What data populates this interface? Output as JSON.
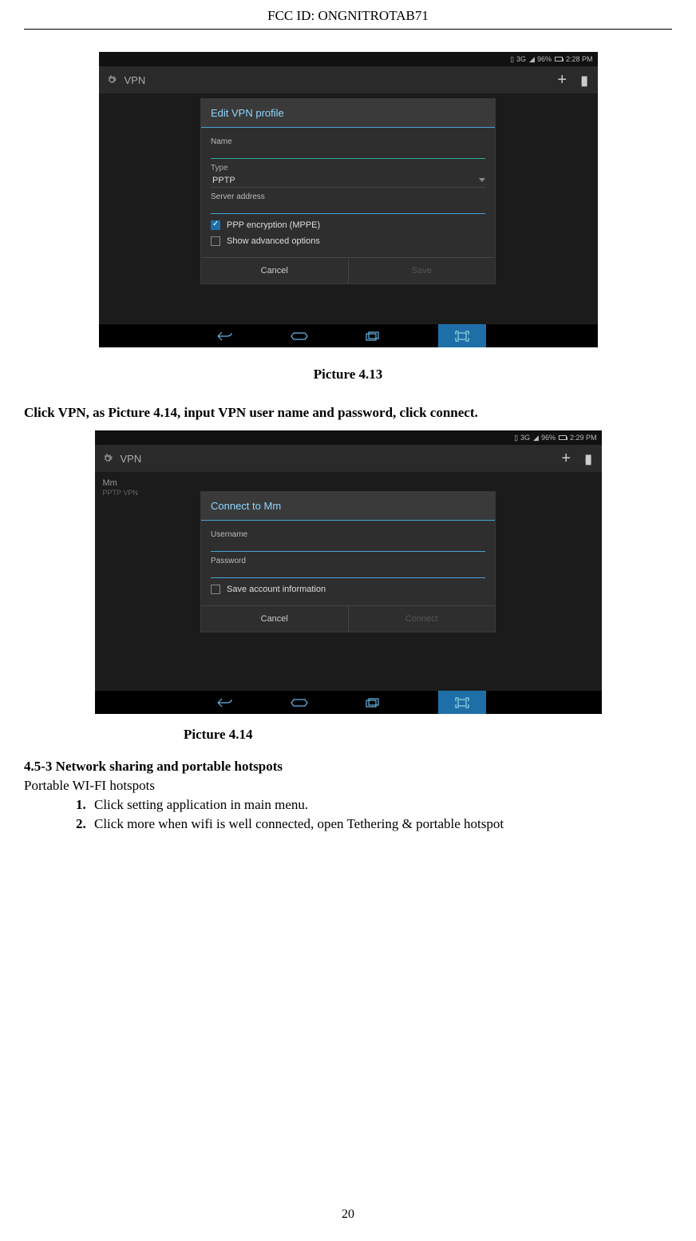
{
  "header": {
    "fcc_label": "FCC ID:",
    "fcc_id": "ONGNITROTAB71"
  },
  "page_number": "20",
  "captions": {
    "pic1": "Picture 4.13",
    "pic2": "Picture 4.14"
  },
  "text": {
    "instruction": "Click VPN, as Picture 4.14, input VPN user name and password, click connect.",
    "section_heading": "4.5-3 Network sharing and portable hotspots",
    "subheading": "Portable WI-FI hotspots",
    "step1": "Click setting application in main menu.",
    "step2": "Click more when wifi is well connected, open Tethering & portable hotspot"
  },
  "shot1": {
    "status": {
      "battery": "96%",
      "time": "2:28 PM",
      "net": "3G"
    },
    "appbar": {
      "title": "VPN"
    },
    "dialog": {
      "title": "Edit VPN profile",
      "name_label": "Name",
      "type_label": "Type",
      "type_value": "PPTP",
      "server_label": "Server address",
      "chk_ppp": "PPP encryption (MPPE)",
      "chk_adv": "Show advanced options",
      "btn_cancel": "Cancel",
      "btn_save": "Save"
    }
  },
  "shot2": {
    "status": {
      "battery": "96%",
      "time": "2:29 PM",
      "net": "3G"
    },
    "appbar": {
      "title": "VPN"
    },
    "list": {
      "name": "Mm",
      "type": "PPTP VPN"
    },
    "dialog": {
      "title": "Connect to Mm",
      "user_label": "Username",
      "pass_label": "Password",
      "chk_save": "Save account information",
      "btn_cancel": "Cancel",
      "btn_connect": "Connect"
    }
  }
}
